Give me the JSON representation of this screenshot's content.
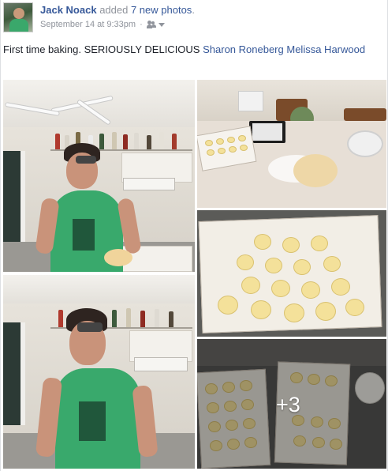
{
  "post": {
    "author": "Jack Noack",
    "action_prefix": "added",
    "action_link": "7 new photos",
    "action_suffix": ".",
    "timestamp": "September 14 at 9:33pm",
    "separator": "·",
    "audience_icon": "friends-icon",
    "caption_text": "First time baking. SERIOUSLY DELICIOUS",
    "tags": [
      "Sharon Roneberg",
      "Melissa Harwood"
    ]
  },
  "gallery": {
    "photo_count_total": 7,
    "more_label": "+3"
  },
  "colors": {
    "link": "#365899",
    "meta": "#90949c",
    "text": "#1d2129"
  }
}
